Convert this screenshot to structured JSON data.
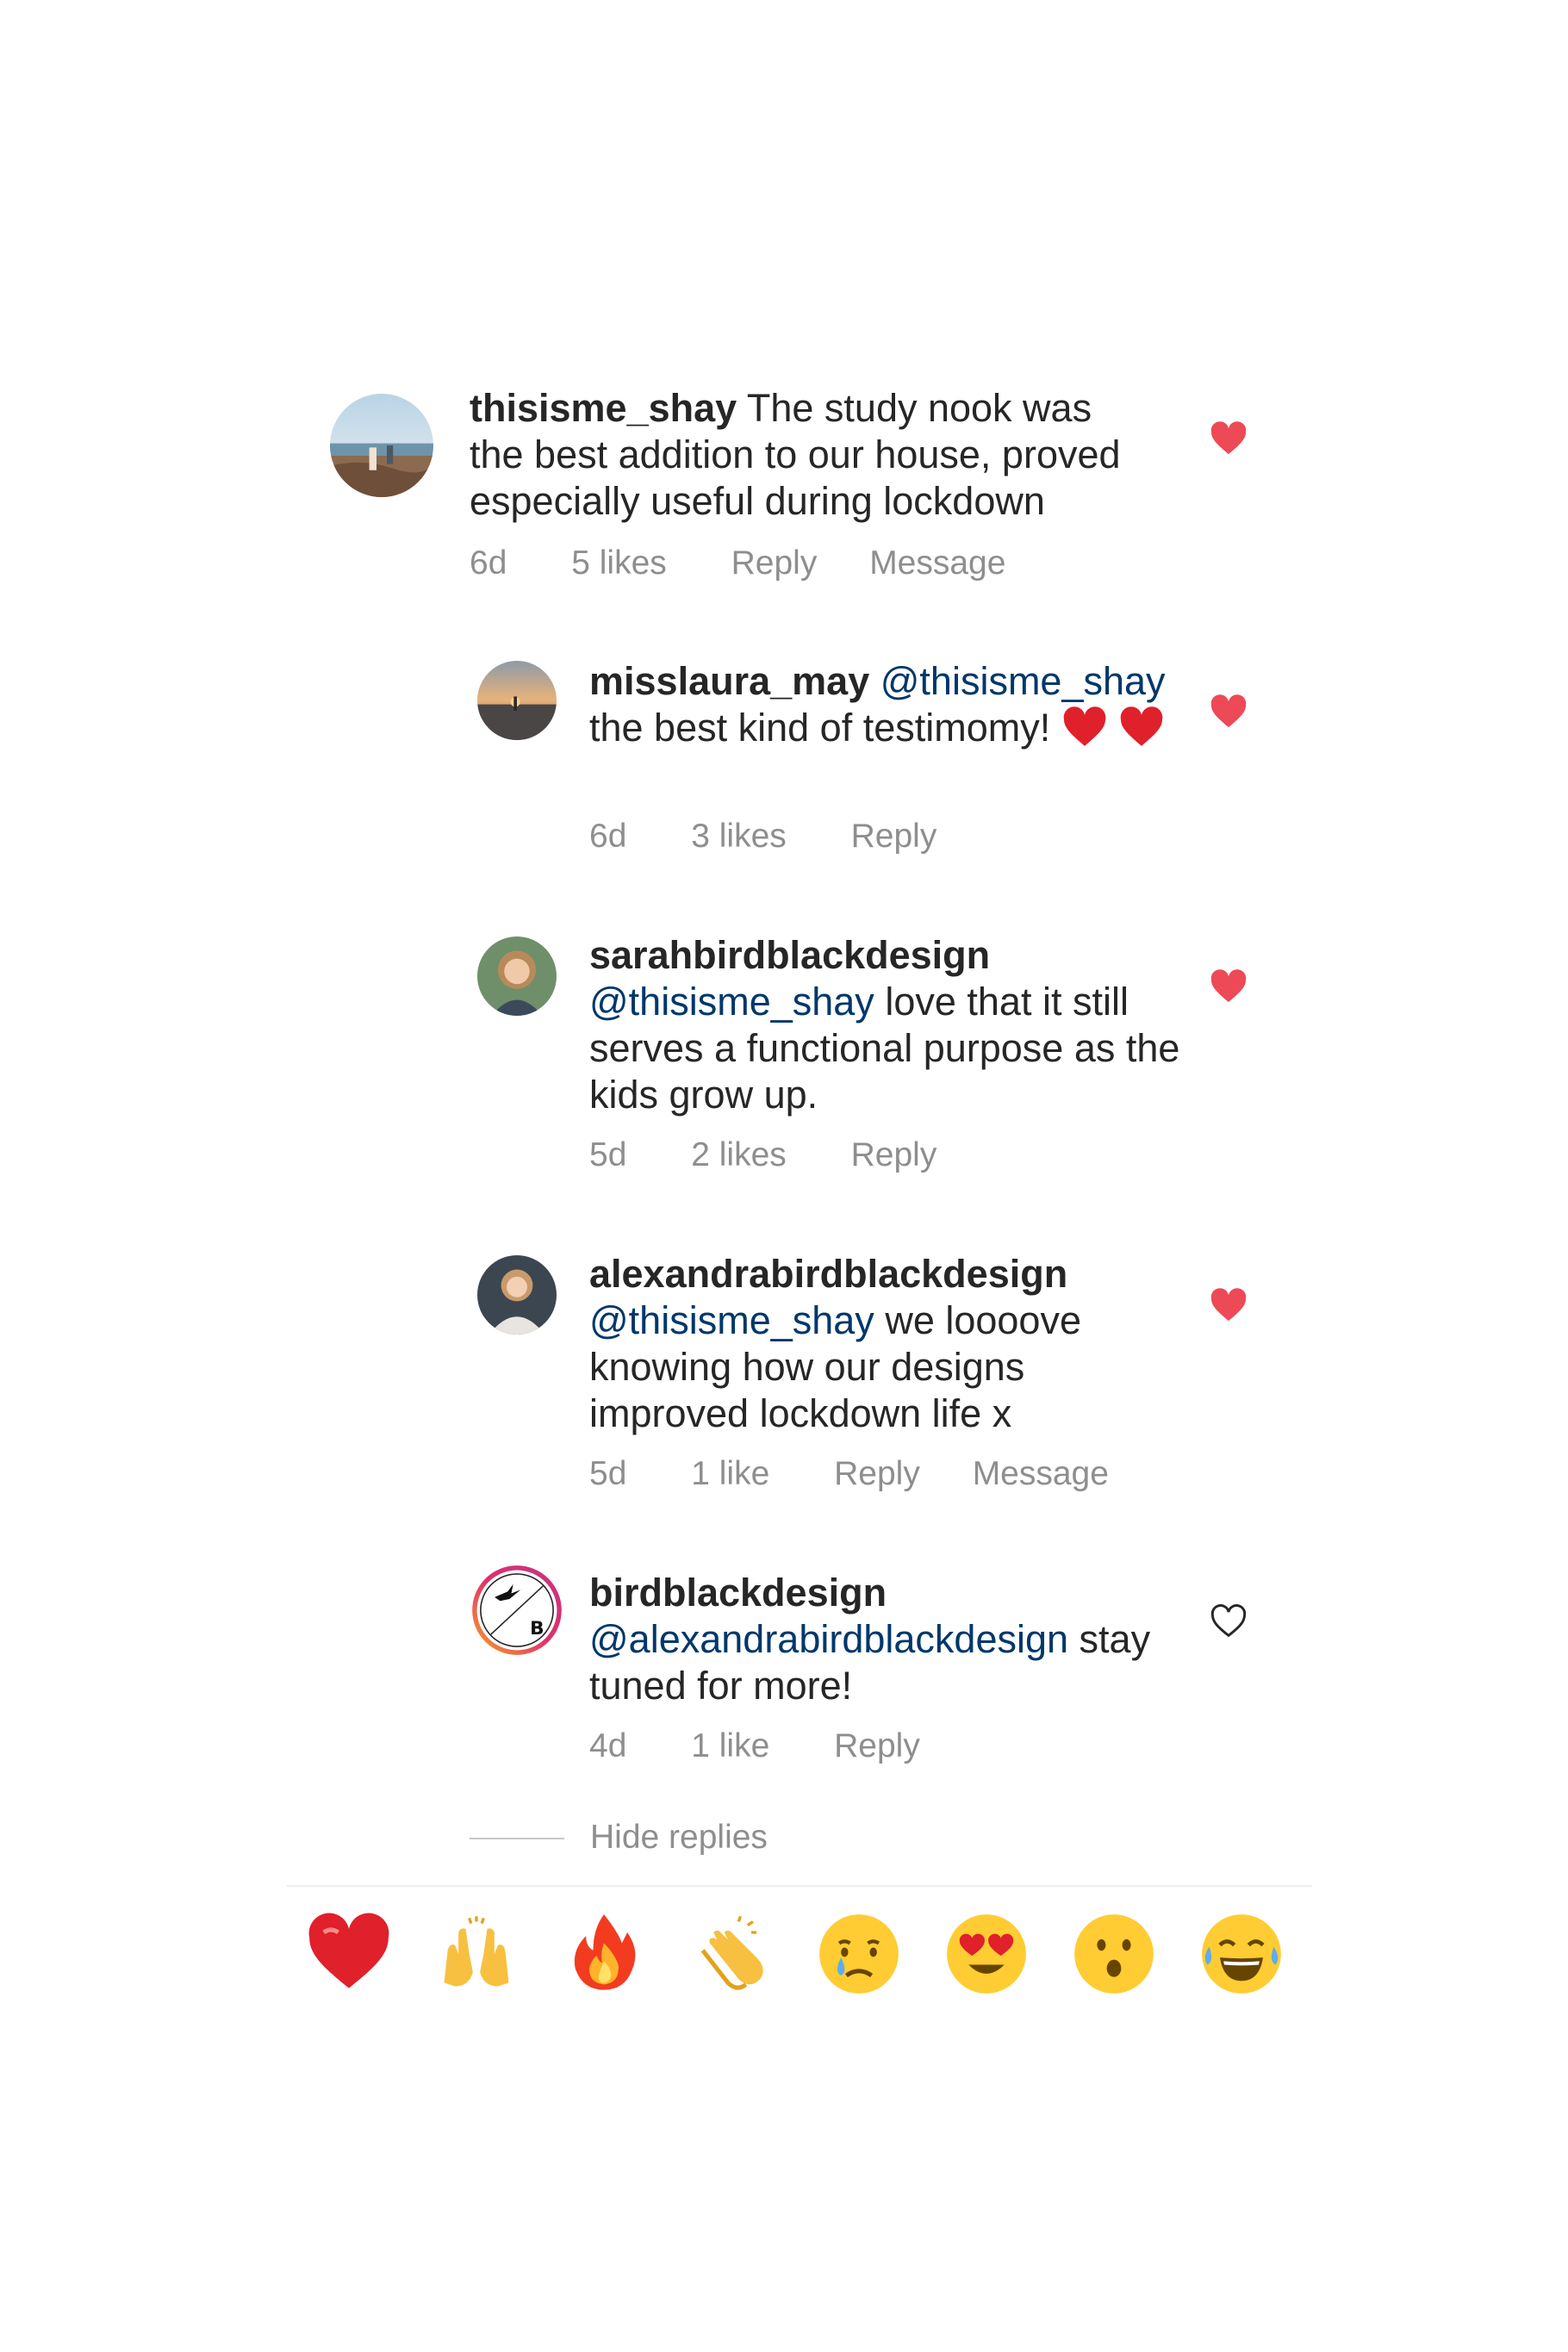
{
  "colors": {
    "liked_heart": "#ed4956",
    "username": "#262626",
    "mention": "#00376b",
    "meta_text": "#8e8e8e",
    "divider": "#efefef"
  },
  "comments": [
    {
      "username": "thisisme_shay",
      "mention": "",
      "text": "The study nook was the best addition to our house, proved especially useful during lockdown",
      "time": "6d",
      "likes": "5 likes",
      "reply": "Reply",
      "message": "Message",
      "liked": true
    },
    {
      "username": "misslaura_may",
      "mention": "@thisisme_shay",
      "text": "the best kind of testimomy!",
      "time": "6d",
      "likes": "3 likes",
      "reply": "Reply",
      "message": "",
      "liked": true
    },
    {
      "username": "sarahbirdblackdesign",
      "mention": "@thisisme_shay",
      "text": "love that it still serves a functional purpose as the kids grow up.",
      "time": "5d",
      "likes": "2 likes",
      "reply": "Reply",
      "message": "",
      "liked": true
    },
    {
      "username": "alexandrabirdblackdesign",
      "mention": "@thisisme_shay",
      "text": "we loooove knowing how our designs improved lockdown life x",
      "time": "5d",
      "likes": "1 like",
      "reply": "Reply",
      "message": "Message",
      "liked": true
    },
    {
      "username": "birdblackdesign",
      "mention": "@alexandrabirdblackdesign",
      "text": "stay tuned for more!",
      "time": "4d",
      "likes": "1 like",
      "reply": "Reply",
      "message": "",
      "liked": false,
      "avatar_logo_letter": "B"
    }
  ],
  "hide_replies": "Hide replies",
  "emoji_bar": [
    "red-heart",
    "raising-hands",
    "fire",
    "clapping-hands",
    "crying-face",
    "heart-eyes-face",
    "surprised-face",
    "tears-of-joy-face"
  ]
}
